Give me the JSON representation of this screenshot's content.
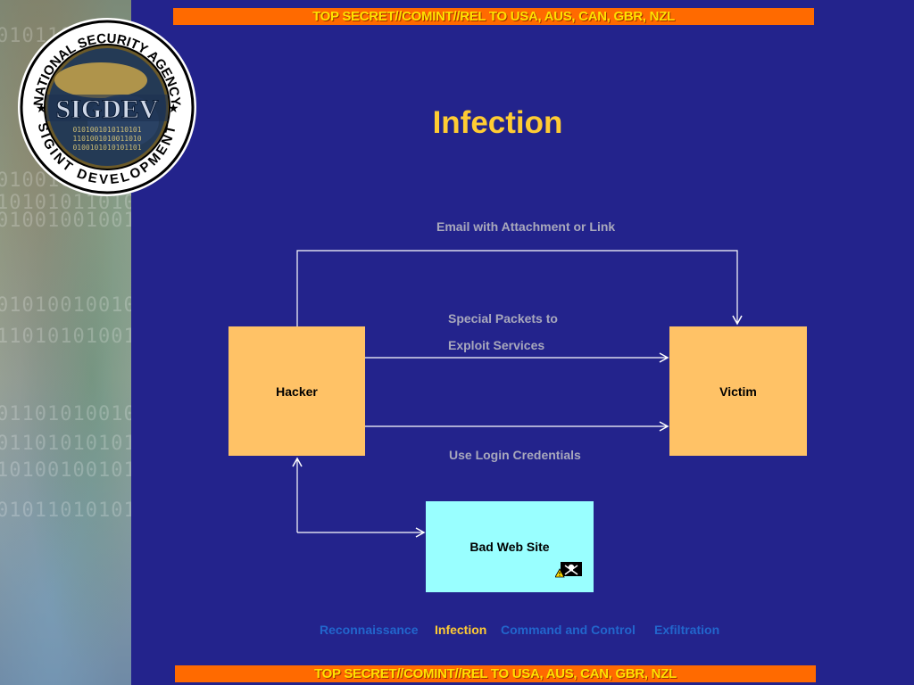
{
  "classification": {
    "top": "TOP SECRET//COMINT//REL TO USA, AUS, CAN, GBR, NZL",
    "bottom": "TOP SECRET//COMINT//REL TO USA, AUS, CAN, GBR, NZL"
  },
  "logo": {
    "outer_text": "NATIONAL SECURITY AGENCY",
    "center_text": "SIGDEV",
    "bottom_text": "SIGINT DEVELOPMENT"
  },
  "title": "Infection",
  "nodes": {
    "hacker": "Hacker",
    "victim": "Victim",
    "bad_web_site": "Bad Web Site"
  },
  "edges": {
    "email": "Email with Attachment or Link",
    "special_packets_line1": "Special Packets to",
    "special_packets_line2": "Exploit Services",
    "login": "Use Login Credentials"
  },
  "nav": {
    "items": [
      {
        "label": "Reconnaissance",
        "color": "#2266cc",
        "active": false
      },
      {
        "label": "Infection",
        "color": "#ffcc33",
        "active": true
      },
      {
        "label": "Command and Control",
        "color": "#2266cc",
        "active": false
      },
      {
        "label": "Exfiltration",
        "color": "#2266cc",
        "active": false
      }
    ]
  },
  "colors": {
    "background": "#23238c",
    "node_orange": "#ffc266",
    "node_cyan": "#99ffff",
    "title": "#ffcc33",
    "banner_bg": "#ff6a00",
    "banner_text": "#ffe100"
  },
  "icons": {
    "warning": "pirate-warning-icon",
    "seal": "sigdev-seal-logo"
  }
}
